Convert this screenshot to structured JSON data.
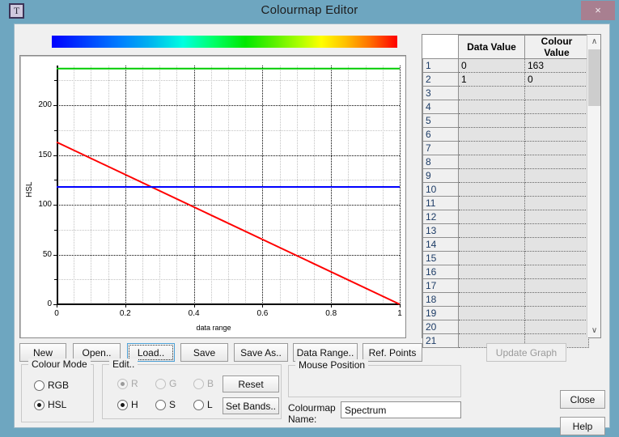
{
  "window": {
    "title": "Colourmap Editor",
    "app_icon": "T",
    "close_label": "×",
    "titlebar_color": "#6ea6c0",
    "close_button_color": "#a87f90"
  },
  "gradient": {
    "name": "spectrum-gradient",
    "stops": [
      "#0000ff",
      "#0080ff",
      "#00ffe0",
      "#00e800",
      "#b0ff00",
      "#ffff00",
      "#ff7000",
      "#ff0000"
    ]
  },
  "chart_data": {
    "type": "line",
    "title": "",
    "xlabel": "data range",
    "ylabel": "HSL",
    "xlim": [
      0,
      1
    ],
    "ylim": [
      0,
      240
    ],
    "xticks": [
      "0",
      "0.2",
      "0.4",
      "0.6",
      "0.8",
      "1"
    ],
    "xtick_values": [
      0,
      0.2,
      0.4,
      0.6,
      0.8,
      1
    ],
    "yticks": [
      "0",
      "50",
      "100",
      "150",
      "200"
    ],
    "ytick_values": [
      0,
      50,
      100,
      150,
      200
    ],
    "grid": true,
    "legend": "none",
    "series": [
      {
        "name": "H",
        "color": "#ff0000",
        "x": [
          0,
          1
        ],
        "values": [
          163,
          0
        ]
      },
      {
        "name": "S",
        "color": "#00cc00",
        "x": [
          0,
          1
        ],
        "values": [
          237,
          237
        ]
      },
      {
        "name": "L",
        "color": "#0000ff",
        "x": [
          0,
          1
        ],
        "values": [
          118,
          118
        ]
      }
    ]
  },
  "table": {
    "columns": [
      "",
      "Data Value",
      "Colour Value"
    ],
    "rows": [
      {
        "n": "1",
        "data_value": "0",
        "colour_value": "163"
      },
      {
        "n": "2",
        "data_value": "1",
        "colour_value": "0"
      },
      {
        "n": "3",
        "data_value": "",
        "colour_value": ""
      },
      {
        "n": "4",
        "data_value": "",
        "colour_value": ""
      },
      {
        "n": "5",
        "data_value": "",
        "colour_value": ""
      },
      {
        "n": "6",
        "data_value": "",
        "colour_value": ""
      },
      {
        "n": "7",
        "data_value": "",
        "colour_value": ""
      },
      {
        "n": "8",
        "data_value": "",
        "colour_value": ""
      },
      {
        "n": "9",
        "data_value": "",
        "colour_value": ""
      },
      {
        "n": "10",
        "data_value": "",
        "colour_value": ""
      },
      {
        "n": "11",
        "data_value": "",
        "colour_value": ""
      },
      {
        "n": "12",
        "data_value": "",
        "colour_value": ""
      },
      {
        "n": "13",
        "data_value": "",
        "colour_value": ""
      },
      {
        "n": "14",
        "data_value": "",
        "colour_value": ""
      },
      {
        "n": "15",
        "data_value": "",
        "colour_value": ""
      },
      {
        "n": "16",
        "data_value": "",
        "colour_value": ""
      },
      {
        "n": "17",
        "data_value": "",
        "colour_value": ""
      },
      {
        "n": "18",
        "data_value": "",
        "colour_value": ""
      },
      {
        "n": "19",
        "data_value": "",
        "colour_value": ""
      },
      {
        "n": "20",
        "data_value": "",
        "colour_value": ""
      },
      {
        "n": "21",
        "data_value": "",
        "colour_value": ""
      }
    ],
    "scroll_up_icon": "∧",
    "scroll_down_icon": "∨"
  },
  "toolbar": {
    "new_label": "New",
    "open_label": "Open..",
    "load_label": "Load..",
    "save_label": "Save",
    "save_as_label": "Save As..",
    "data_range_label": "Data Range..",
    "ref_points_label": "Ref. Points",
    "update_graph_label": "Update Graph"
  },
  "colour_mode": {
    "legend": "Colour Mode",
    "options": [
      {
        "label": "RGB",
        "checked": false
      },
      {
        "label": "HSL",
        "checked": true
      }
    ]
  },
  "edit": {
    "legend": "Edit..",
    "rgb_options": [
      {
        "label": "R",
        "checked": true,
        "disabled": true
      },
      {
        "label": "G",
        "checked": false,
        "disabled": true
      },
      {
        "label": "B",
        "checked": false,
        "disabled": true
      }
    ],
    "hsl_options": [
      {
        "label": "H",
        "checked": true,
        "disabled": false
      },
      {
        "label": "S",
        "checked": false,
        "disabled": false
      },
      {
        "label": "L",
        "checked": false,
        "disabled": false
      }
    ],
    "reset_label": "Reset",
    "set_bands_label": "Set Bands.."
  },
  "mouse_position": {
    "legend": "Mouse Position",
    "value": ""
  },
  "colourmap_name": {
    "label_line1": "Colourmap",
    "label_line2": "Name:",
    "value": "Spectrum",
    "placeholder": ""
  },
  "actions": {
    "close_label": "Close",
    "help_label": "Help"
  }
}
